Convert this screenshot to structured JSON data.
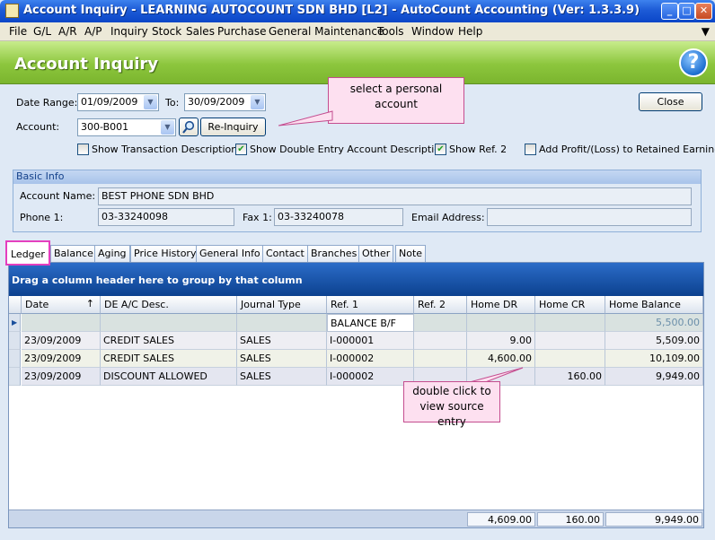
{
  "window": {
    "title": "Account Inquiry - LEARNING AUTOCOUNT SDN BHD [L2] - AutoCount Accounting (Ver: 1.3.3.9)"
  },
  "menu": [
    "File",
    "G/L",
    "A/R",
    "A/P",
    "Inquiry",
    "Stock",
    "Sales",
    "Purchase",
    "General Maintenance",
    "Tools",
    "Window",
    "Help"
  ],
  "header": {
    "title": "Account Inquiry"
  },
  "filters": {
    "date_range_label": "Date Range:",
    "date_from": "01/09/2009",
    "to_label": "To:",
    "date_to": "30/09/2009",
    "account_label": "Account:",
    "account": "300-B001",
    "reinquiry_label": "Re-Inquiry",
    "close_label": "Close"
  },
  "options": [
    {
      "label": "Show Transaction Description",
      "checked": false
    },
    {
      "label": "Show Double Entry Account Description",
      "checked": true
    },
    {
      "label": "Show Ref. 2",
      "checked": true
    },
    {
      "label": "Add Profit/(Loss) to Retained Earning",
      "checked": false
    }
  ],
  "basic_info": {
    "title": "Basic Info",
    "account_name_label": "Account Name:",
    "account_name": "BEST PHONE SDN BHD",
    "phone_label": "Phone 1:",
    "phone": "03-33240098",
    "fax_label": "Fax 1:",
    "fax": "03-33240078",
    "email_label": "Email Address:",
    "email": ""
  },
  "tabs": [
    "Ledger",
    "Balance",
    "Aging",
    "Price History",
    "General Info",
    "Contact",
    "Branches",
    "Other",
    "Note"
  ],
  "grid": {
    "group_hint": "Drag a column header here to group by that column",
    "columns": [
      "Date",
      "DE A/C Desc.",
      "Journal Type",
      "Ref. 1",
      "Ref. 2",
      "Home DR",
      "Home CR",
      "Home Balance"
    ],
    "sort_indicator": "↑",
    "rows": [
      {
        "date": "",
        "desc": "",
        "jtype": "",
        "ref1": "BALANCE B/F",
        "ref2": "",
        "dr": "",
        "cr": "",
        "bal": "5,500.00"
      },
      {
        "date": "23/09/2009",
        "desc": "CREDIT SALES",
        "jtype": "SALES",
        "ref1": "I-000001",
        "ref2": "",
        "dr": "9.00",
        "cr": "",
        "bal": "5,509.00"
      },
      {
        "date": "23/09/2009",
        "desc": "CREDIT SALES",
        "jtype": "SALES",
        "ref1": "I-000002",
        "ref2": "",
        "dr": "4,600.00",
        "cr": "",
        "bal": "10,109.00"
      },
      {
        "date": "23/09/2009",
        "desc": "DISCOUNT ALLOWED",
        "jtype": "SALES",
        "ref1": "I-000002",
        "ref2": "",
        "dr": "",
        "cr": "160.00",
        "bal": "9,949.00"
      }
    ],
    "totals": {
      "dr": "4,609.00",
      "cr": "160.00",
      "bal": "9,949.00"
    }
  },
  "callouts": {
    "account": "select a personal account",
    "grid": "double click to view source entry"
  },
  "icons": {
    "help": "help-icon",
    "search": "search-icon",
    "app": "app-icon"
  },
  "colors": {
    "accent": "#8cc63d",
    "titlebar": "#1d5bd6",
    "highlight": "#e43fbf"
  }
}
